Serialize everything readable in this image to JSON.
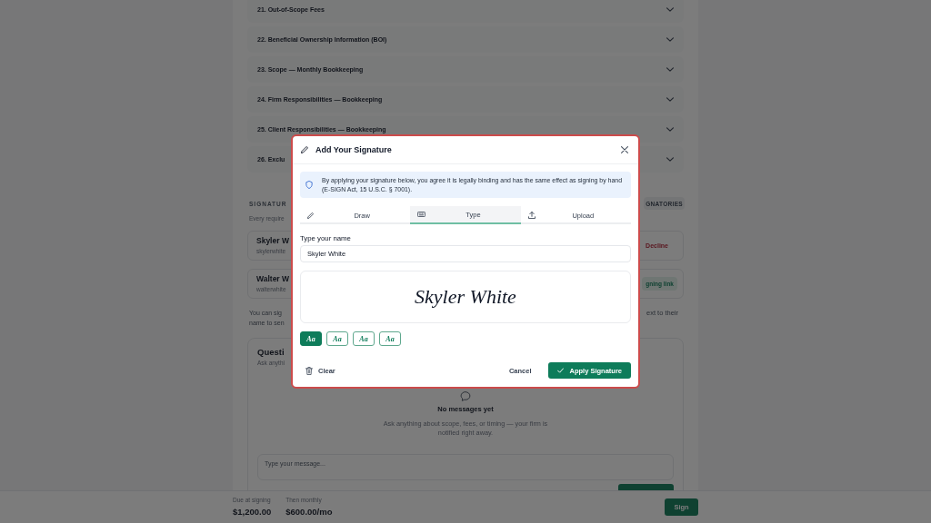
{
  "page": {
    "sections": [
      {
        "title": "21. Out-of-Scope Fees",
        "expanded": false
      },
      {
        "title": "22. Beneficial Ownership Information (BOI)",
        "expanded": false
      },
      {
        "title": "23. Scope — Monthly Bookkeeping",
        "expanded": false
      },
      {
        "title": "24. Firm Responsibilities — Bookkeeping",
        "expanded": false
      },
      {
        "title": "25. Client Responsibilities — Bookkeeping",
        "expanded": false
      },
      {
        "title": "26. Exclu",
        "expanded": false
      }
    ],
    "signatures": {
      "heading": "SIGNATUR",
      "header_button": "GNATORIES",
      "note": "Every require",
      "signers": [
        {
          "name": "Skyler W",
          "email": "skylerwhite",
          "action": "Decline",
          "kind": "decline"
        },
        {
          "name": "Walter W",
          "email": "walterwhite",
          "action": "gning link",
          "kind": "link"
        }
      ],
      "hint_left": [
        "You can sig",
        "name to sen"
      ],
      "hint_right": "ext to their"
    },
    "questions": {
      "title": "Questi",
      "subtitle": "Ask anythi",
      "empty_title": "No messages yet",
      "empty_text": "Ask anything about scope, fees, or timing — your firm is notified right away.",
      "message_placeholder": "Type your message..."
    }
  },
  "footer": {
    "amounts": [
      {
        "label": "Due at signing",
        "value": "$1,200.00"
      },
      {
        "label": "Then monthly",
        "value": "$600.00/mo"
      }
    ],
    "sign_button": "Sign"
  },
  "dialog": {
    "title": "Add Your Signature",
    "notice": "By applying your signature below, you agree it is legally binding and has the same effect as signing by hand (E-SIGN Act, 15 U.S.C. § 7001).",
    "tabs": [
      {
        "label": "Draw",
        "kind": "draw",
        "selected": false
      },
      {
        "label": "Type",
        "kind": "type",
        "selected": true
      },
      {
        "label": "Upload",
        "kind": "upload",
        "selected": false
      }
    ],
    "name_label": "Type your name",
    "name_value": "Skyler White",
    "preview": "Skyler White",
    "font_options": [
      {
        "label": "Aa",
        "selected": true
      },
      {
        "label": "Aa",
        "selected": false
      },
      {
        "label": "Aa",
        "selected": false
      },
      {
        "label": "Aa",
        "selected": false
      }
    ],
    "clear_button": "Clear",
    "cancel_button": "Cancel",
    "apply_button": "Apply Signature"
  }
}
